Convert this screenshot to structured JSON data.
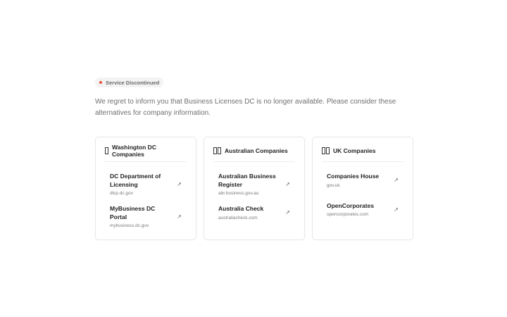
{
  "status": {
    "label": "Service Discontinued",
    "dot_color": "#e5533d"
  },
  "message": "We regret to inform you that Business Licenses DC is no longer available. Please consider these alternatives for company information.",
  "cards": [
    {
      "title": "Washington DC Companies",
      "flag_icon": "flag-icon",
      "links": [
        {
          "name": "DC Department of Licensing",
          "url": "dlcp.dc.gov"
        },
        {
          "name": "MyBusiness DC Portal",
          "url": "mybusiness.dc.gov"
        }
      ]
    },
    {
      "title": "Australian Companies",
      "flag_icon": "flag-icon",
      "links": [
        {
          "name": "Australian Business Register",
          "url": "abr.business.gov.au"
        },
        {
          "name": "Australia Check",
          "url": "australiacheck.com"
        }
      ]
    },
    {
      "title": "UK Companies",
      "flag_icon": "flag-icon",
      "links": [
        {
          "name": "Companies House",
          "url": "gov.uk"
        },
        {
          "name": "OpenCorporates",
          "url": "opencorporates.com"
        }
      ]
    }
  ],
  "link_arrow": "↗"
}
